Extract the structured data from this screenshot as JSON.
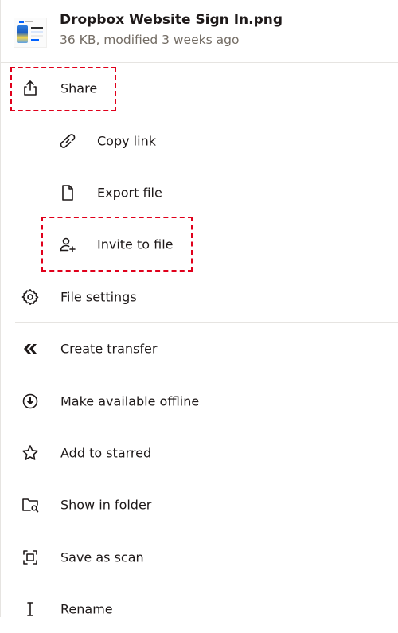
{
  "file": {
    "name": "Dropbox Website Sign In.png",
    "meta": "36 KB, modified 3 weeks ago"
  },
  "menu": {
    "share": "Share",
    "copy_link": "Copy link",
    "export_file": "Export file",
    "invite_to_file": "Invite to file",
    "file_settings": "File settings",
    "create_transfer": "Create transfer",
    "make_available_offline": "Make available offline",
    "add_to_starred": "Add to starred",
    "show_in_folder": "Show in folder",
    "save_as_scan": "Save as scan",
    "rename": "Rename"
  },
  "icons": {
    "share": "share-icon",
    "copy_link": "link-icon",
    "export_file": "file-icon",
    "invite_to_file": "person-add-icon",
    "file_settings": "gear-icon",
    "create_transfer": "transfer-icon",
    "make_available_offline": "download-circle-icon",
    "add_to_starred": "star-icon",
    "show_in_folder": "folder-search-icon",
    "save_as_scan": "scan-icon",
    "rename": "text-cursor-icon"
  },
  "colors": {
    "text": "#1e1919",
    "secondary_text": "#736c64",
    "divider": "#e6e4e1",
    "annotation": "#e0001b"
  }
}
